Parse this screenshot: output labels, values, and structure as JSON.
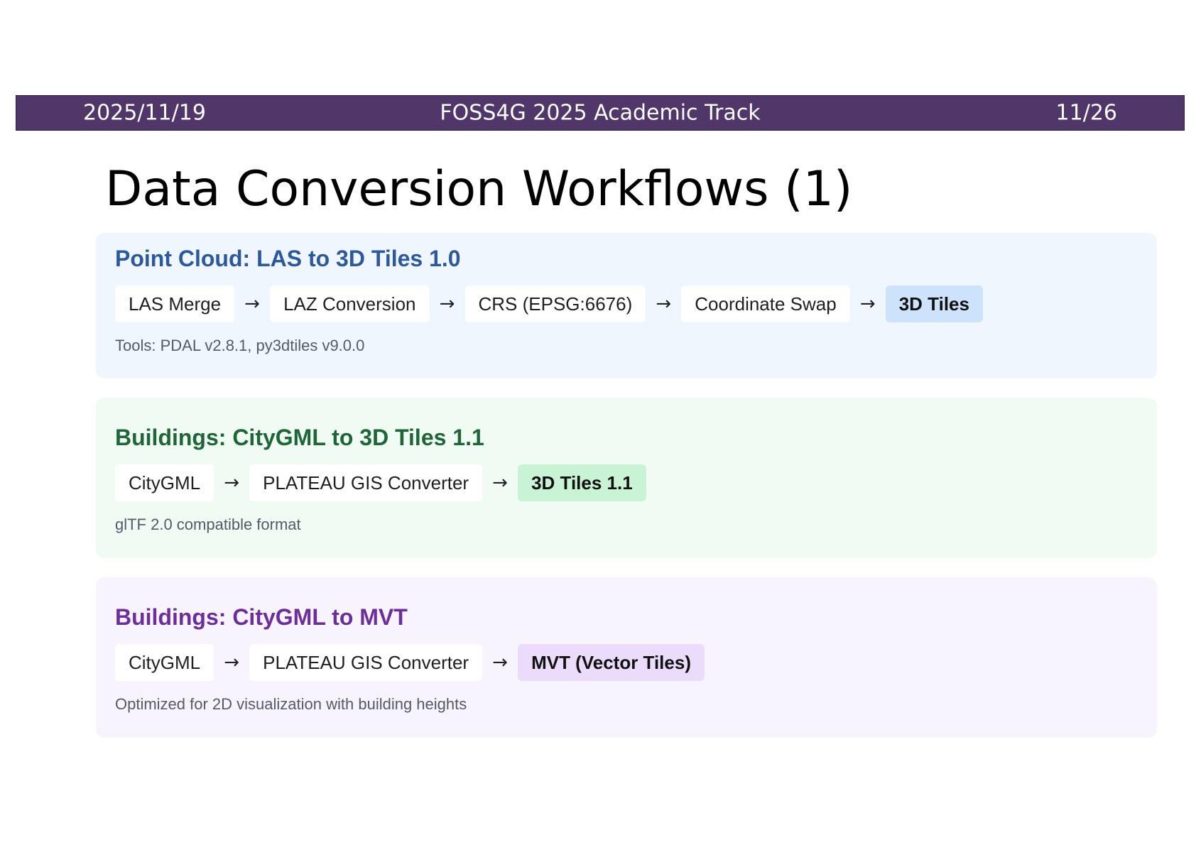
{
  "header": {
    "date": "2025/11/19",
    "event": "FOSS4G 2025 Academic Track",
    "page": "11/26",
    "bar_color": "#51366a"
  },
  "slide": {
    "title": "Data Conversion Workflows (1)"
  },
  "workflows": [
    {
      "title": "Point Cloud: LAS to 3D Tiles 1.0",
      "title_color": "#2c58a0",
      "background": "#eff6fe",
      "steps": [
        "LAS Merge",
        "LAZ Conversion",
        "CRS (EPSG:6676)",
        "Coordinate Swap",
        "3D Tiles"
      ],
      "note": "Tools: PDAL v2.8.1, py3dtiles v9.0.0"
    },
    {
      "title": "Buildings: CityGML to 3D Tiles 1.1",
      "title_color": "#1e6637",
      "background": "#f0fcf3",
      "steps": [
        "CityGML",
        "PLATEAU GIS Converter",
        "3D Tiles 1.1"
      ],
      "note": "glTF 2.0 compatible format"
    },
    {
      "title": "Buildings: CityGML to MVT",
      "title_color": "#6e2d9d",
      "background": "#f8f4fe",
      "steps": [
        "CityGML",
        "PLATEAU GIS Converter",
        "MVT (Vector Tiles)"
      ],
      "note": "Optimized for 2D visualization with building heights"
    }
  ],
  "arrow_glyph": "→"
}
